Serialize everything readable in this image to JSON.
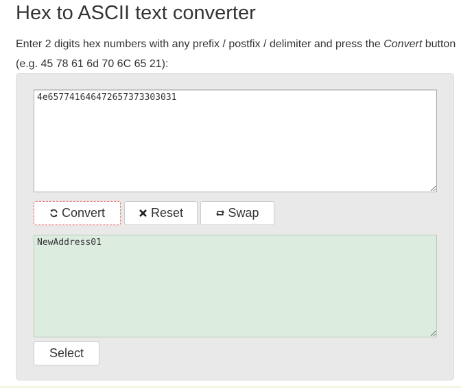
{
  "page": {
    "title": "Hex to ASCII text converter",
    "intro_before": "Enter 2 digits hex numbers with any prefix / postfix / delimiter and press the ",
    "intro_emphasis": "Convert",
    "intro_after": " button (e.g. 45 78 61 6d 70 6C 65 21):"
  },
  "converter": {
    "input_value": "4e657741646472657373303031",
    "output_value": "NewAddress01",
    "buttons": {
      "convert_label": "Convert",
      "convert_icon": "refresh-icon",
      "reset_label": "Reset",
      "reset_icon": "close-icon",
      "swap_label": "Swap",
      "swap_icon": "swap-icon",
      "select_label": "Select"
    }
  },
  "colors": {
    "panel_background": "#e9e9e9",
    "output_background": "#dcecdf",
    "focus_outline": "#e07c7c",
    "text": "#333333"
  }
}
